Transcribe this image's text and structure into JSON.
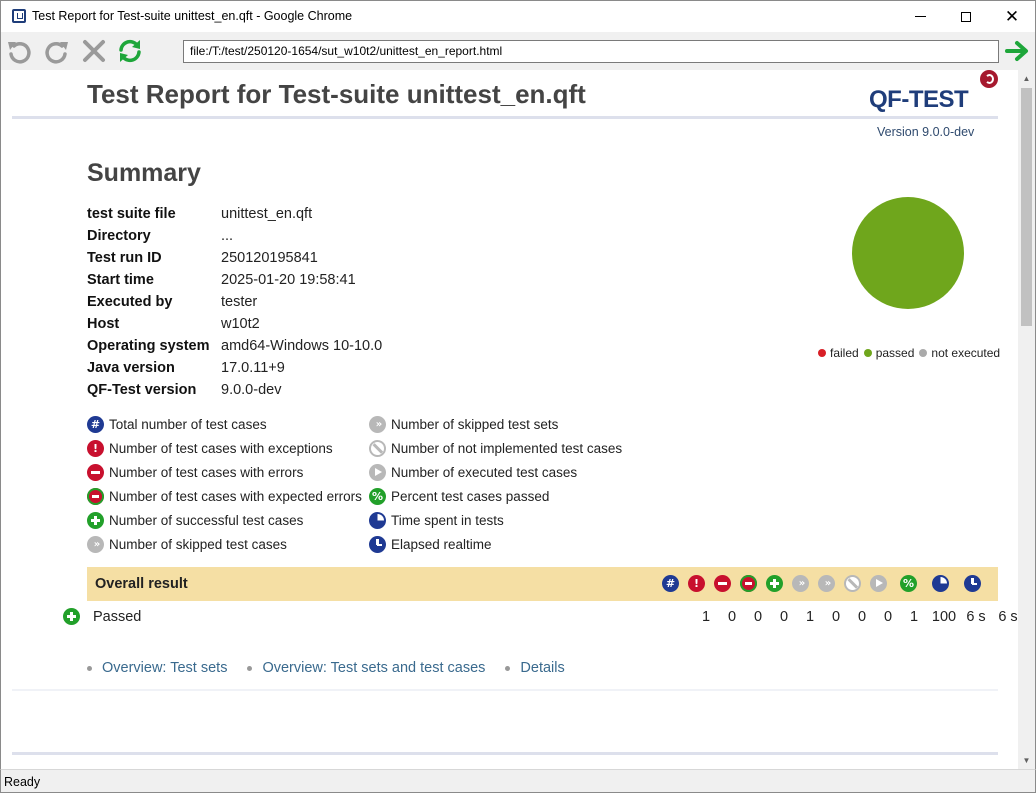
{
  "window": {
    "title": "Test Report for Test-suite unittest_en.qft - Google Chrome",
    "close_glyph": "✕"
  },
  "browser": {
    "url": "file:/T:/test/250120-1654/sut_w10t2/unittest_en_report.html",
    "status": "Ready",
    "icons": [
      "back-icon",
      "forward-icon",
      "stop-icon",
      "reload-icon",
      "go-arrow-icon"
    ]
  },
  "report": {
    "title": "Test Report for Test-suite unittest_en.qft",
    "logo_text": "QF-TEST",
    "version": "Version 9.0.0-dev",
    "summary_heading": "Summary",
    "info": [
      {
        "label": "test suite file",
        "value": "unittest_en.qft"
      },
      {
        "label": "Directory",
        "value": "..."
      },
      {
        "label": "Test run ID",
        "value": "250120195841"
      },
      {
        "label": "Start time",
        "value": "2025-01-20 19:58:41"
      },
      {
        "label": "Executed by",
        "value": "tester"
      },
      {
        "label": "Host",
        "value": "w10t2"
      },
      {
        "label": "Operating system",
        "value": "amd64-Windows 10-10.0"
      },
      {
        "label": "Java version",
        "value": "17.0.11+9"
      },
      {
        "label": "QF-Test version",
        "value": "9.0.0-dev"
      }
    ],
    "pie_legend": [
      {
        "label": "failed",
        "color": "#d81f26"
      },
      {
        "label": "passed",
        "color": "#6fa61c"
      },
      {
        "label": "not executed",
        "color": "#aaaaaa"
      }
    ],
    "legend_left": [
      {
        "icon": "hash-icon",
        "glyph": "#",
        "label": "Total number of test cases"
      },
      {
        "icon": "exception-icon",
        "glyph": "!",
        "label": "Number of test cases with exceptions"
      },
      {
        "icon": "error-icon",
        "glyph": "",
        "label": "Number of test cases with errors"
      },
      {
        "icon": "expected-error-icon",
        "glyph": "",
        "label": "Number of test cases with expected errors"
      },
      {
        "icon": "success-icon",
        "glyph": "",
        "label": "Number of successful test cases"
      },
      {
        "icon": "skipped-icon",
        "glyph": "»",
        "label": "Number of skipped test cases"
      }
    ],
    "legend_right": [
      {
        "icon": "skipped-sets-icon",
        "glyph": "»",
        "label": "Number of skipped test sets"
      },
      {
        "icon": "not-implemented-icon",
        "glyph": "",
        "label": "Number of not implemented test cases"
      },
      {
        "icon": "executed-icon",
        "glyph": "",
        "label": "Number of executed test cases"
      },
      {
        "icon": "percent-icon",
        "glyph": "%",
        "label": "Percent test cases passed"
      },
      {
        "icon": "time-spent-icon",
        "glyph": "",
        "label": "Time spent in tests"
      },
      {
        "icon": "elapsed-icon",
        "glyph": "",
        "label": "Elapsed realtime"
      }
    ],
    "overall": {
      "heading": "Overall result",
      "status": "Passed",
      "values": [
        "1",
        "0",
        "0",
        "0",
        "1",
        "0",
        "0",
        "0",
        "1",
        "100",
        "6 s",
        "6 s"
      ]
    },
    "nav_links": [
      "Overview: Test sets",
      "Overview: Test sets and test cases",
      "Details"
    ]
  },
  "chart_data": {
    "type": "pie",
    "categories": [
      "failed",
      "passed",
      "not executed"
    ],
    "values": [
      0,
      1,
      0
    ],
    "colors": [
      "#d81f26",
      "#6fa61c",
      "#aaaaaa"
    ],
    "legend": "bottom"
  }
}
